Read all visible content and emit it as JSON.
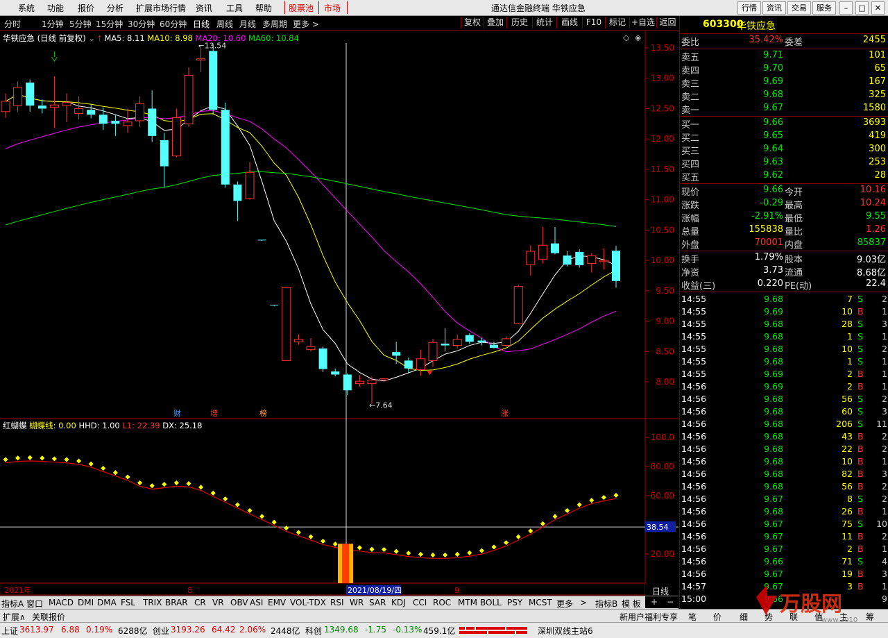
{
  "menu": {
    "items": [
      "系统",
      "功能",
      "报价",
      "分析",
      "扩展市场行情",
      "资讯",
      "工具",
      "帮助"
    ],
    "highlight": [
      "股票池",
      "市场"
    ],
    "title": "通达信金融终端 华铁应急",
    "right_buttons": [
      "行情",
      "资讯",
      "交易",
      "服务"
    ]
  },
  "periods": {
    "items": [
      "分时",
      "1分钟",
      "5分钟",
      "15分钟",
      "30分钟",
      "60分钟",
      "日线",
      "周线",
      "月线",
      "多周期",
      "更多 >"
    ],
    "selected": "日线",
    "right_buttons": [
      "复权",
      "叠加",
      "历史",
      "统计",
      "画线",
      "F10",
      "标记",
      "+自选",
      "返回"
    ]
  },
  "info_line": {
    "name": "华铁应急 (日线 前复权)",
    "ma5": "MA5: 8.11",
    "ma10": "MA10: 8.98",
    "ma20": "MA20: 10.60",
    "ma60": "MA60: 10.84"
  },
  "main_chart": {
    "yticks": [
      "13.50",
      "13.00",
      "12.50",
      "12.00",
      "11.50",
      "11.00",
      "10.50",
      "10.00",
      "9.50",
      "9.00",
      "8.50",
      "8.00"
    ],
    "high_label": "13.54",
    "low_label": "7.64",
    "event_labels": [
      "财",
      "增",
      "榜",
      "涨"
    ]
  },
  "chart_data": {
    "type": "candlestick",
    "ylim": [
      7.5,
      13.75
    ],
    "candles": [
      {
        "o": 12.45,
        "c": 12.62,
        "h": 12.75,
        "l": 12.35
      },
      {
        "o": 12.55,
        "c": 12.85,
        "h": 12.95,
        "l": 12.45
      },
      {
        "o": 12.93,
        "c": 12.55,
        "h": 12.98,
        "l": 12.45
      },
      {
        "o": 12.55,
        "c": 12.5,
        "h": 12.65,
        "l": 12.42
      },
      {
        "o": 12.52,
        "c": 12.56,
        "h": 13.03,
        "l": 12.18
      },
      {
        "o": 12.55,
        "c": 12.6,
        "h": 12.75,
        "l": 12.28
      },
      {
        "o": 12.42,
        "c": 12.5,
        "h": 12.7,
        "l": 12.32
      },
      {
        "o": 12.48,
        "c": 12.4,
        "h": 12.58,
        "l": 12.34
      },
      {
        "o": 12.4,
        "c": 12.25,
        "h": 12.52,
        "l": 12.15
      },
      {
        "o": 12.3,
        "c": 12.25,
        "h": 12.4,
        "l": 12.05
      },
      {
        "o": 12.22,
        "c": 12.28,
        "h": 12.5,
        "l": 12.1
      },
      {
        "o": 12.3,
        "c": 12.58,
        "h": 12.7,
        "l": 12.2
      },
      {
        "o": 12.5,
        "c": 12.05,
        "h": 12.8,
        "l": 11.95
      },
      {
        "o": 11.98,
        "c": 11.55,
        "h": 12.1,
        "l": 11.2
      },
      {
        "o": 11.72,
        "c": 12.35,
        "h": 12.5,
        "l": 11.7
      },
      {
        "o": 12.25,
        "c": 13.05,
        "h": 13.18,
        "l": 12.2
      },
      {
        "o": 13.3,
        "c": 13.32,
        "h": 13.54,
        "l": 13.1
      },
      {
        "o": 13.45,
        "c": 12.48,
        "h": 13.55,
        "l": 12.4
      },
      {
        "o": 12.48,
        "c": 11.25,
        "h": 12.6,
        "l": 11.2
      },
      {
        "o": 11.25,
        "c": 10.98,
        "h": 11.3,
        "l": 10.65
      },
      {
        "o": 11.02,
        "c": 11.45,
        "h": 11.62,
        "l": 11.0
      },
      {
        "o": 10.34,
        "c": 10.33,
        "h": 10.34,
        "l": 10.32
      },
      {
        "o": 9.27,
        "c": 9.26,
        "h": 9.27,
        "l": 9.25
      },
      {
        "o": 8.35,
        "c": 9.55,
        "h": 9.55,
        "l": 8.35
      },
      {
        "o": 8.66,
        "c": 8.7,
        "h": 8.78,
        "l": 8.61
      },
      {
        "o": 8.53,
        "c": 8.58,
        "h": 8.72,
        "l": 8.5
      },
      {
        "o": 8.55,
        "c": 8.21,
        "h": 8.58,
        "l": 8.16
      },
      {
        "o": 8.17,
        "c": 8.12,
        "h": 8.22,
        "l": 8.09
      },
      {
        "o": 8.12,
        "c": 7.86,
        "h": 8.14,
        "l": 7.78
      },
      {
        "o": 7.97,
        "c": 8.01,
        "h": 8.11,
        "l": 7.92
      },
      {
        "o": 7.97,
        "c": 8.03,
        "h": 8.08,
        "l": 7.64
      },
      {
        "o": 8.03,
        "c": 8.05,
        "h": 8.06,
        "l": 8.0
      },
      {
        "o": 8.49,
        "c": 8.43,
        "h": 8.66,
        "l": 8.3
      },
      {
        "o": 8.35,
        "c": 8.22,
        "h": 8.4,
        "l": 8.15
      },
      {
        "o": 8.2,
        "c": 8.38,
        "h": 8.53,
        "l": 8.1
      },
      {
        "o": 8.35,
        "c": 8.65,
        "h": 8.71,
        "l": 8.25
      },
      {
        "o": 8.63,
        "c": 8.6,
        "h": 8.88,
        "l": 8.5
      },
      {
        "o": 8.6,
        "c": 8.7,
        "h": 8.78,
        "l": 8.55
      },
      {
        "o": 8.77,
        "c": 8.66,
        "h": 8.8,
        "l": 8.62
      },
      {
        "o": 8.68,
        "c": 8.65,
        "h": 8.72,
        "l": 8.6
      },
      {
        "o": 8.61,
        "c": 8.56,
        "h": 8.66,
        "l": 8.55
      },
      {
        "o": 8.6,
        "c": 8.71,
        "h": 8.75,
        "l": 8.55
      },
      {
        "o": 8.96,
        "c": 9.57,
        "h": 9.6,
        "l": 8.95
      },
      {
        "o": 9.93,
        "c": 10.15,
        "h": 10.25,
        "l": 9.75
      },
      {
        "o": 10.02,
        "c": 10.25,
        "h": 10.55,
        "l": 9.95
      },
      {
        "o": 10.28,
        "c": 10.12,
        "h": 10.55,
        "l": 10.1
      },
      {
        "o": 10.08,
        "c": 9.93,
        "h": 10.15,
        "l": 9.9
      },
      {
        "o": 10.14,
        "c": 9.92,
        "h": 10.18,
        "l": 9.88
      },
      {
        "o": 9.95,
        "c": 10.08,
        "h": 10.12,
        "l": 9.8
      },
      {
        "o": 9.98,
        "c": 10.0,
        "h": 10.2,
        "l": 9.85
      },
      {
        "o": 10.16,
        "c": 9.66,
        "h": 10.24,
        "l": 9.55
      }
    ]
  },
  "indicator": {
    "name": "红蝴蝶",
    "line1": "蝴蝶线: 0.00",
    "line2": "HHD: 1.00",
    "line3": "L1: 22.39",
    "line4": "DX: 25.18",
    "yticks": [
      "100.0",
      "80.00",
      "60.00",
      "20.00"
    ],
    "crosshair_value": "38.54"
  },
  "xaxis": {
    "labels": [
      "2021年",
      "8",
      "2021/08/19/四",
      "9"
    ]
  },
  "right_panel": {
    "code": "603300",
    "name": "华铁应急",
    "weibi_label": "委比",
    "weibi": "35.42%",
    "weicha_label": "委差",
    "weicha": "2455",
    "asks": [
      {
        "label": "卖五",
        "price": "9.71",
        "vol": "101"
      },
      {
        "label": "卖四",
        "price": "9.70",
        "vol": "65"
      },
      {
        "label": "卖三",
        "price": "9.69",
        "vol": "167"
      },
      {
        "label": "卖二",
        "price": "9.68",
        "vol": "325"
      },
      {
        "label": "卖一",
        "price": "9.67",
        "vol": "1580"
      }
    ],
    "bids": [
      {
        "label": "买一",
        "price": "9.66",
        "vol": "3693"
      },
      {
        "label": "买二",
        "price": "9.65",
        "vol": "419"
      },
      {
        "label": "买三",
        "price": "9.64",
        "vol": "300"
      },
      {
        "label": "买四",
        "price": "9.63",
        "vol": "253"
      },
      {
        "label": "买五",
        "price": "9.62",
        "vol": "28"
      }
    ],
    "quote": [
      {
        "l1": "现价",
        "v1": "9.66",
        "c1": "grn",
        "l2": "今开",
        "v2": "10.16",
        "c2": "red"
      },
      {
        "l1": "涨跌",
        "v1": "-0.29",
        "c1": "grn",
        "l2": "最高",
        "v2": "10.24",
        "c2": "red"
      },
      {
        "l1": "涨幅",
        "v1": "-2.91%",
        "c1": "grn",
        "l2": "最低",
        "v2": "9.55",
        "c2": "grn"
      },
      {
        "l1": "总量",
        "v1": "155838",
        "c1": "yel",
        "l2": "量比",
        "v2": "1.26",
        "c2": "red"
      },
      {
        "l1": "外盘",
        "v1": "70001",
        "c1": "red",
        "l2": "内盘",
        "v2": "85837",
        "c2": "grn"
      }
    ],
    "finance": [
      {
        "l1": "换手",
        "v1": "1.79%",
        "l2": "股本",
        "v2": "9.03亿"
      },
      {
        "l1": "净资",
        "v1": "3.73",
        "l2": "流通",
        "v2": "8.68亿"
      },
      {
        "l1": "收益(三)",
        "v1": "0.220",
        "l2": "PE(动)",
        "v2": "22.4"
      }
    ],
    "ticks": [
      {
        "t": "14:55",
        "p": "9.68",
        "v": "7",
        "s": "S",
        "n": "2"
      },
      {
        "t": "14:55",
        "p": "9.69",
        "v": "10",
        "s": "B",
        "n": "1"
      },
      {
        "t": "14:55",
        "p": "9.68",
        "v": "28",
        "s": "S",
        "n": "3"
      },
      {
        "t": "14:55",
        "p": "9.68",
        "v": "1",
        "s": "S",
        "n": "1"
      },
      {
        "t": "14:55",
        "p": "9.68",
        "v": "10",
        "s": "S",
        "n": "2"
      },
      {
        "t": "14:55",
        "p": "9.68",
        "v": "1",
        "s": "S",
        "n": "1"
      },
      {
        "t": "14:55",
        "p": "9.69",
        "v": "2",
        "s": "B",
        "n": "1"
      },
      {
        "t": "14:56",
        "p": "9.69",
        "v": "2",
        "s": "B",
        "n": "1"
      },
      {
        "t": "14:56",
        "p": "9.68",
        "v": "56",
        "s": "S",
        "n": "2"
      },
      {
        "t": "14:56",
        "p": "9.68",
        "v": "60",
        "s": "S",
        "n": "3"
      },
      {
        "t": "14:56",
        "p": "9.68",
        "v": "206",
        "s": "S",
        "n": "11"
      },
      {
        "t": "14:56",
        "p": "9.68",
        "v": "43",
        "s": "B",
        "n": "2"
      },
      {
        "t": "14:56",
        "p": "9.68",
        "v": "22",
        "s": "B",
        "n": "2"
      },
      {
        "t": "14:56",
        "p": "9.68",
        "v": "10",
        "s": "B",
        "n": "1"
      },
      {
        "t": "14:56",
        "p": "9.68",
        "v": "82",
        "s": "B",
        "n": "3"
      },
      {
        "t": "14:56",
        "p": "9.68",
        "v": "56",
        "s": "B",
        "n": "2"
      },
      {
        "t": "14:56",
        "p": "9.67",
        "v": "8",
        "s": "S",
        "n": "2"
      },
      {
        "t": "14:56",
        "p": "9.68",
        "v": "26",
        "s": "B",
        "n": "1"
      },
      {
        "t": "14:56",
        "p": "9.67",
        "v": "75",
        "s": "S",
        "n": "10"
      },
      {
        "t": "14:56",
        "p": "9.67",
        "v": "11",
        "s": "B",
        "n": "2"
      },
      {
        "t": "14:56",
        "p": "9.67",
        "v": "2",
        "s": "B",
        "n": "1"
      },
      {
        "t": "14:56",
        "p": "9.66",
        "v": "71",
        "s": "S",
        "n": "4"
      },
      {
        "t": "14:56",
        "p": "9.67",
        "v": "19",
        "s": "B",
        "n": "3"
      },
      {
        "t": "14:57",
        "p": "9.67",
        "v": "3",
        "s": "B",
        "n": "1"
      },
      {
        "t": "15:00",
        "p": "9.66",
        "v": "",
        "s": "",
        "n": "9"
      }
    ]
  },
  "tabs": {
    "items": [
      "指标A",
      "窗口",
      "MACD",
      "DMI",
      "DMA",
      "FSL",
      "TRIX",
      "BRAR",
      "CR",
      "VR",
      "OBV",
      "ASI",
      "EMV",
      "VOL-TDX",
      "RSI",
      "WR",
      "SAR",
      "KDJ",
      "CCI",
      "ROC",
      "MTM",
      "BOLL",
      "PSY",
      "MCST",
      "更多",
      ">"
    ],
    "right": [
      "指标B",
      "模 板"
    ],
    "panel_right": [
      "日线",
      "+",
      "−"
    ]
  },
  "subbar": {
    "left": [
      "扩展∧",
      "关联报价"
    ],
    "mid": "新用户福利专享",
    "right": [
      "笔",
      "价",
      "细",
      "势",
      "联",
      "值",
      "主",
      "筹"
    ]
  },
  "status": {
    "sh_label": "上证",
    "sh": "3613.97",
    "sh_chg": "6.88",
    "sh_pct": "0.19%",
    "sh_amt": "6288亿",
    "cy_label": "创业",
    "cy": "3193.26",
    "cy_chg": "64.42",
    "cy_pct": "2.06%",
    "cy_amt": "2448亿",
    "kc_label": "科创",
    "kc": "1349.68",
    "kc_chg": "-1.75",
    "kc_pct": "-0.13%",
    "kc_amt": "459.1亿",
    "server": "深圳双线主站6"
  },
  "watermark": {
    "brand": "万股网",
    "url": "www.2010"
  },
  "colors": {
    "up": "#ff3232",
    "down": "#54ffff",
    "ma5": "#ffffff",
    "ma10": "#ffff00",
    "ma20": "#ff00ff",
    "ma60": "#00e600"
  }
}
